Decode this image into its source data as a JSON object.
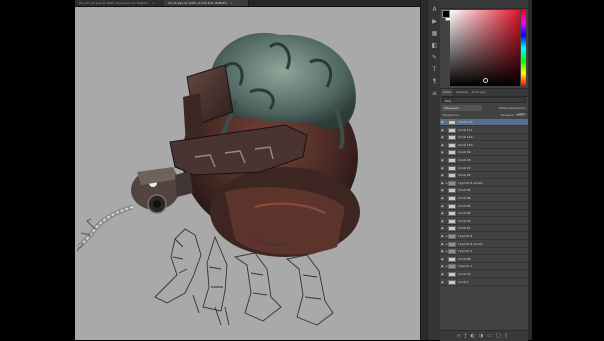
{
  "tabs": [
    {
      "label": "s5_sol1_s0.psd @ 100% (Сургачи 14, RGB/8*)",
      "active": false,
      "close": "×"
    },
    {
      "label": "s5_05.psd @ 100% (Слой 153, RGB/8*)",
      "active": true,
      "close": "×"
    }
  ],
  "mini_tools": [
    "a-icon",
    "play-icon",
    "grid-icon",
    "swatch-icon",
    "brush-icon",
    "text-icon",
    "paragraph-icon",
    "layers-icon"
  ],
  "layers_panel": {
    "tabs": [
      "Слои",
      "Каналы",
      "Контуры"
    ],
    "kind_label": "Вид",
    "blend_mode": "Обычные",
    "opacity_label": "Непрозрачность: 100%",
    "lock_label": "Закрепить:",
    "fill_label": "Заливка: 100%",
    "layers": [
      {
        "name": "Слой 153",
        "selected": true,
        "folder": false
      },
      {
        "name": "Слой 151",
        "selected": false,
        "folder": false
      },
      {
        "name": "Слой 149",
        "selected": false,
        "folder": false
      },
      {
        "name": "Слой 150",
        "selected": false,
        "folder": false
      },
      {
        "name": "Слой 99",
        "selected": false,
        "folder": false
      },
      {
        "name": "Слой 93",
        "selected": false,
        "folder": false
      },
      {
        "name": "Слой 92",
        "selected": false,
        "folder": false
      },
      {
        "name": "Слой 95",
        "selected": false,
        "folder": false
      },
      {
        "name": "Группа 8 копия",
        "selected": false,
        "folder": true
      },
      {
        "name": "Слой 84",
        "selected": false,
        "folder": false
      },
      {
        "name": "Слой 86",
        "selected": false,
        "folder": false
      },
      {
        "name": "Слой 85",
        "selected": false,
        "folder": false
      },
      {
        "name": "Слой 89",
        "selected": false,
        "folder": false
      },
      {
        "name": "Слой 90",
        "selected": false,
        "folder": false
      },
      {
        "name": "Слой 87",
        "selected": false,
        "folder": false
      },
      {
        "name": "Группа 8",
        "selected": false,
        "folder": true
      },
      {
        "name": "Группа 8 копия",
        "selected": false,
        "folder": true
      },
      {
        "name": "Группа 2",
        "selected": false,
        "folder": true
      },
      {
        "name": "Слой 88",
        "selected": false,
        "folder": false
      },
      {
        "name": "Группа 1",
        "selected": false,
        "folder": true
      },
      {
        "name": "Слой 33",
        "selected": false,
        "folder": false
      },
      {
        "name": "Слой 1",
        "selected": false,
        "folder": false
      }
    ],
    "footer_icons": [
      "link-icon",
      "fx-icon",
      "mask-icon",
      "adjust-icon",
      "folder-icon",
      "new-layer-icon",
      "trash-icon"
    ]
  },
  "colors": {
    "canvas_bg": "#a9a9a9",
    "panel_bg": "#424242",
    "selected_layer": "#5a6e8c",
    "picker_hue": "#e0132a"
  }
}
